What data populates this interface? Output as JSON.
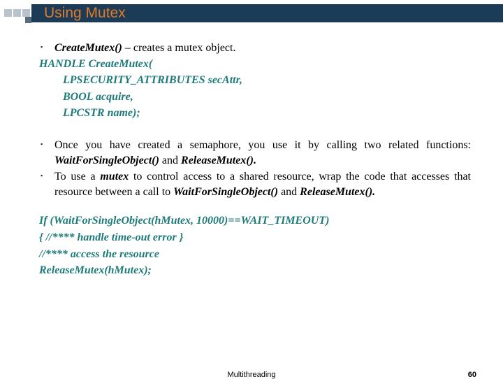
{
  "title": "Using Mutex",
  "b1_a": "CreateMutex()",
  "b1_b": " – creates a mutex object.",
  "sig_line1": "HANDLE CreateMutex(",
  "sig_line2": "LPSECURITY_ATTRIBUTES secAttr,",
  "sig_line3": "BOOL acquire,",
  "sig_line4": "LPCSTR name);",
  "b2_a": "Once you have created a semaphore, you use it by calling two related functions: ",
  "b2_b": "WaitForSingleObject()",
  "b2_c": " and ",
  "b2_d": "ReleaseMutex().",
  "b3_a": "To use a ",
  "b3_b": "mutex",
  "b3_c": " to control access to a shared resource, wrap the code that accesses that resource between a call to ",
  "b3_d": "WaitForSingleObject()",
  "b3_e": " and ",
  "b3_f": "ReleaseMutex().",
  "code1": "If (WaitForSingleObject(hMutex, 10000)==WAIT_TIMEOUT)",
  "code2": " { //**** handle time-out error }",
  "code3": " //**** access the resource",
  "code4": "ReleaseMutex(hMutex);",
  "footer_center": "Multithreading",
  "footer_page": "60"
}
